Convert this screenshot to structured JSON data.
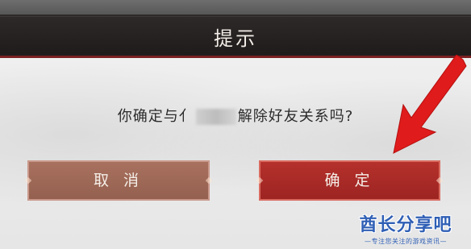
{
  "dialog": {
    "title": "提示",
    "message_prefix": "你确定与",
    "message_partial": "亻",
    "message_suffix": "解除好友关系吗?",
    "cancel_label": "取 消",
    "confirm_label": "确 定"
  },
  "watermark": {
    "brand": "酋长分享吧",
    "tagline": "—专注您关注的游戏资讯—"
  },
  "colors": {
    "header_bg": "#241f1f",
    "header_border": "#7a1f22",
    "body_bg": "#ececec",
    "cancel_bg": "#9d6756",
    "confirm_bg": "#a82a27",
    "arrow": "#e01b1b",
    "watermark": "#2f5fb5"
  },
  "icons": {
    "arrow": "red-pointer-arrow-icon"
  }
}
